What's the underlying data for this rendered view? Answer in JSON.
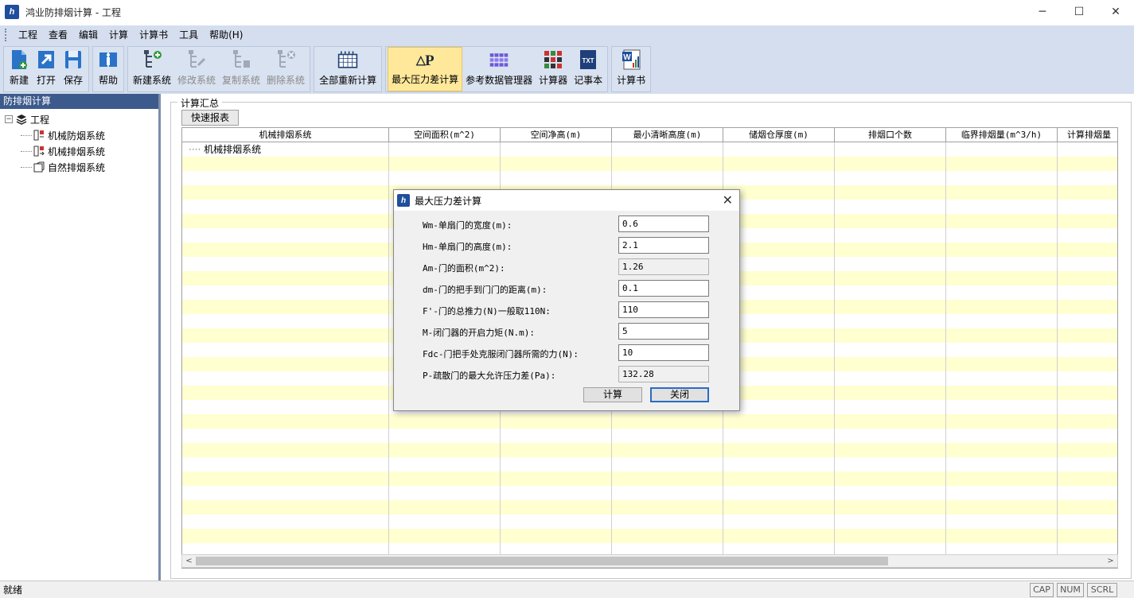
{
  "window": {
    "title": "鸿业防排烟计算 - 工程",
    "icon": "app-logo-icon"
  },
  "menu": [
    "工程",
    "查看",
    "编辑",
    "计算",
    "计算书",
    "工具",
    "帮助(H)"
  ],
  "toolbar": {
    "groups": [
      [
        {
          "label": "新建",
          "icon": "new-file-icon",
          "enabled": true
        },
        {
          "label": "打开",
          "icon": "open-icon",
          "enabled": true
        },
        {
          "label": "保存",
          "icon": "save-icon",
          "enabled": true
        }
      ],
      [
        {
          "label": "帮助",
          "icon": "help-book-icon",
          "enabled": true
        }
      ],
      [
        {
          "label": "新建系统",
          "icon": "new-system-icon",
          "enabled": true
        },
        {
          "label": "修改系统",
          "icon": "edit-system-icon",
          "enabled": false
        },
        {
          "label": "复制系统",
          "icon": "copy-system-icon",
          "enabled": false
        },
        {
          "label": "删除系统",
          "icon": "delete-system-icon",
          "enabled": false
        }
      ],
      [
        {
          "label": "全部重新计算",
          "icon": "recalc-all-icon",
          "enabled": true
        }
      ],
      [
        {
          "label": "最大压力差计算",
          "icon": "delta-p-icon",
          "enabled": true,
          "active": true
        },
        {
          "label": "参考数据管理器",
          "icon": "data-manager-icon",
          "enabled": true
        },
        {
          "label": "计算器",
          "icon": "calculator-icon",
          "enabled": true
        },
        {
          "label": "记事本",
          "icon": "notepad-icon",
          "enabled": true
        }
      ],
      [
        {
          "label": "计算书",
          "icon": "word-doc-icon",
          "enabled": true
        }
      ]
    ]
  },
  "left_panel": {
    "title": "防排烟计算",
    "tree": {
      "root": "工程",
      "children": [
        "机械防烟系统",
        "机械排烟系统",
        "自然排烟系统"
      ]
    }
  },
  "main": {
    "group_title": "计算汇总",
    "quick_report_label": "快速报表",
    "grid": {
      "columns": [
        "机械排烟系统",
        "空间面积(m^2)",
        "空间净高(m)",
        "最小清晰高度(m)",
        "储烟仓厚度(m)",
        "排烟口个数",
        "临界排烟量(m^3/h)",
        "计算排烟量"
      ],
      "first_row": "机械排烟系统"
    }
  },
  "dialog": {
    "title": "最大压力差计算",
    "fields": [
      {
        "label": "Wm-单扇门的宽度(m):",
        "value": "0.6",
        "readonly": false
      },
      {
        "label": "Hm-单扇门的高度(m):",
        "value": "2.1",
        "readonly": false
      },
      {
        "label": "Am-门的面积(m^2):",
        "value": "1.26",
        "readonly": true
      },
      {
        "label": "dm-门的把手到门门的距离(m):",
        "value": "0.1",
        "readonly": false
      },
      {
        "label": "F'-门的总推力(N)一般取110N:",
        "value": "110",
        "readonly": false
      },
      {
        "label": "M-闭门器的开启力矩(N.m):",
        "value": "5",
        "readonly": false
      },
      {
        "label": "Fdc-门把手处克服闭门器所需的力(N):",
        "value": "10",
        "readonly": false
      },
      {
        "label": "P-疏散门的最大允许压力差(Pa):",
        "value": "132.28",
        "readonly": true
      }
    ],
    "calc_label": "计算",
    "close_label": "关闭"
  },
  "status": {
    "text": "就绪",
    "indicators": [
      "CAP",
      "NUM",
      "SCRL"
    ]
  }
}
